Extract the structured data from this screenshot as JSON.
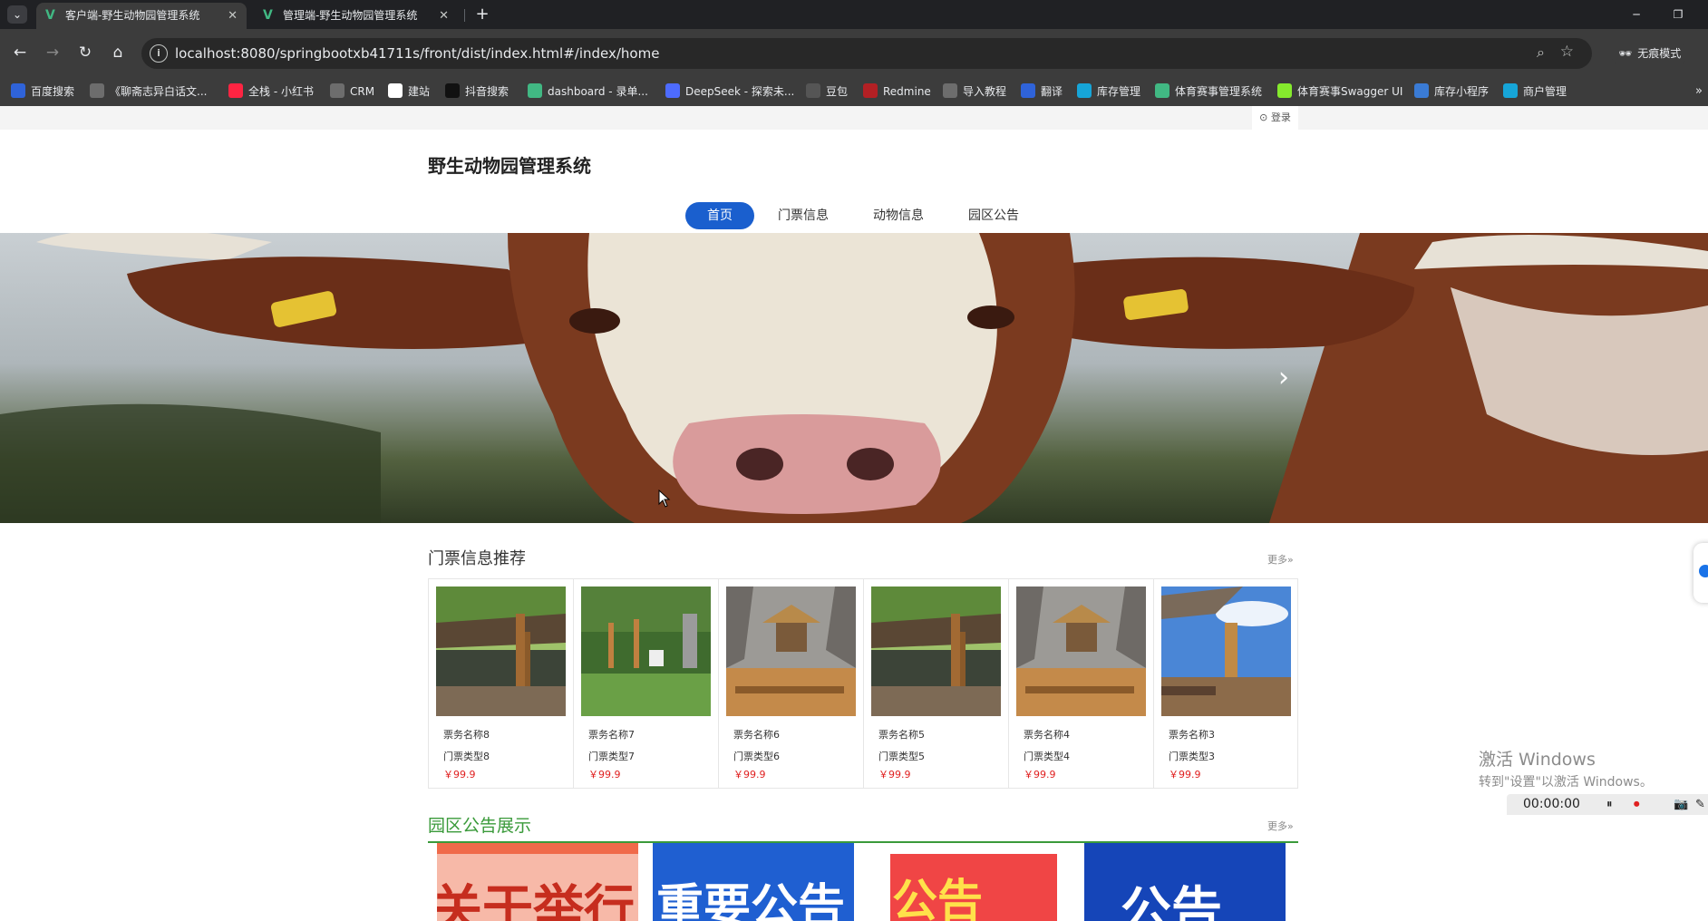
{
  "browser": {
    "tabs": [
      {
        "title": "客户端-野生动物园管理系统",
        "active": true
      },
      {
        "title": "管理端-野生动物园管理系统",
        "active": false
      }
    ],
    "new_tab": "+",
    "url": "localhost:8080/springbootxb41711s/front/dist/index.html#/index/home",
    "incognito_label": "无痕模式",
    "bookmarks": [
      {
        "label": "百度搜索",
        "color": "#2f63d9"
      },
      {
        "label": "《聊斋志异白话文...",
        "color": "#6d6d6d"
      },
      {
        "label": "全栈 - 小红书",
        "color": "#ff2442"
      },
      {
        "label": "CRM",
        "color": "#6d6d6d"
      },
      {
        "label": "建站",
        "color": "#ffffff"
      },
      {
        "label": "抖音搜索",
        "color": "#111111"
      },
      {
        "label": "dashboard - 录单...",
        "color": "#41b883"
      },
      {
        "label": "DeepSeek - 探索未...",
        "color": "#4d6bfe"
      },
      {
        "label": "豆包",
        "color": "#555555"
      },
      {
        "label": "Redmine",
        "color": "#b32024"
      },
      {
        "label": "导入教程",
        "color": "#6d6d6d"
      },
      {
        "label": "翻译",
        "color": "#2f63d9"
      },
      {
        "label": "库存管理",
        "color": "#16a5d8"
      },
      {
        "label": "体育赛事管理系统",
        "color": "#41b883"
      },
      {
        "label": "体育赛事Swagger UI",
        "color": "#85ea2d"
      },
      {
        "label": "库存小程序",
        "color": "#3a7bd5"
      },
      {
        "label": "商户管理",
        "color": "#16a5d8"
      }
    ],
    "bookmarks_more": "»"
  },
  "site": {
    "login": "登录",
    "title": "野生动物园管理系统",
    "nav": [
      "首页",
      "门票信息",
      "动物信息",
      "园区公告"
    ],
    "active_nav": 0
  },
  "banner": {
    "next_icon": "chevron-right-icon",
    "dots": 1
  },
  "tickets": {
    "title": "门票信息推荐",
    "more": "更多»",
    "items": [
      {
        "name": "票务名称8",
        "type": "门票类型8",
        "price": "￥99.9",
        "scene": "giraffe-pavilion"
      },
      {
        "name": "票务名称7",
        "type": "门票类型7",
        "price": "￥99.9",
        "scene": "giraffe-zebra"
      },
      {
        "name": "票务名称6",
        "type": "门票类型6",
        "price": "￥99.9",
        "scene": "rock-hut"
      },
      {
        "name": "票务名称5",
        "type": "门票类型5",
        "price": "￥99.9",
        "scene": "giraffe-pavilion"
      },
      {
        "name": "票务名称4",
        "type": "门票类型4",
        "price": "￥99.9",
        "scene": "rock-hut"
      },
      {
        "name": "票务名称3",
        "type": "门票类型3",
        "price": "￥99.9",
        "scene": "giraffe-sky"
      }
    ]
  },
  "notices": {
    "title": "园区公告展示",
    "more": "更多»",
    "items": [
      {
        "text": "关于举行",
        "bg": "#f06a4a"
      },
      {
        "text": "重要公告",
        "bg": "#1f5fd1"
      },
      {
        "text": "公告",
        "bg": "#f04545"
      },
      {
        "text": "公告",
        "bg": "#1545b8"
      }
    ]
  },
  "overlay": {
    "windows_line1": "激活 Windows",
    "windows_line2": "转到\"设置\"以激活 Windows。",
    "recorder_time": "00:00:00"
  }
}
